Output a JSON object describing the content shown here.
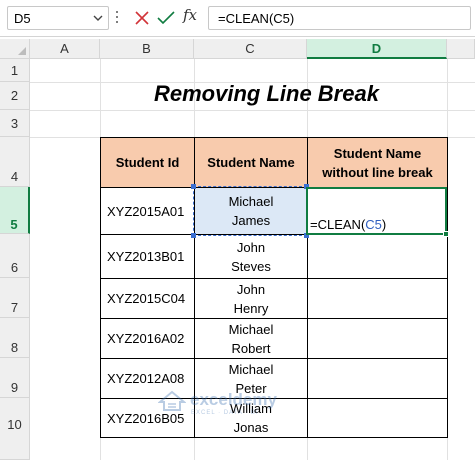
{
  "formula_bar": {
    "name_box": "D5",
    "fx_label": "fx",
    "formula": "=CLEAN(C5)"
  },
  "columns": [
    "A",
    "B",
    "C",
    "D"
  ],
  "rows": [
    "1",
    "2",
    "3",
    "4",
    "5",
    "6",
    "7",
    "8",
    "9",
    "10"
  ],
  "sheet": {
    "title": "Removing Line Break",
    "table": {
      "headers": [
        "Student Id",
        "Student Name",
        "Student Name\nwithout line break"
      ],
      "rows": [
        {
          "id": "XYZ2015A01",
          "name": "Michael\nJames",
          "result": ""
        },
        {
          "id": "XYZ2013B01",
          "name": "John\nSteves",
          "result": ""
        },
        {
          "id": "XYZ2015C04",
          "name": "John\nHenry",
          "result": ""
        },
        {
          "id": "XYZ2016A02",
          "name": "Michael\nRobert",
          "result": ""
        },
        {
          "id": "XYZ2012A08",
          "name": "Michael\nPeter",
          "result": ""
        },
        {
          "id": "XYZ2016B05",
          "name": "William\nJonas",
          "result": ""
        }
      ]
    },
    "active_cell_edit": {
      "prefix": "=CLEAN(",
      "ref": "C5",
      "suffix": ")"
    }
  },
  "watermark": {
    "name": "exceldemy",
    "tagline": "EXCEL · DATA · BI"
  },
  "colors": {
    "accent": "#107c41",
    "header_fill": "#f8cbad",
    "reference": "#3b6fd1"
  }
}
